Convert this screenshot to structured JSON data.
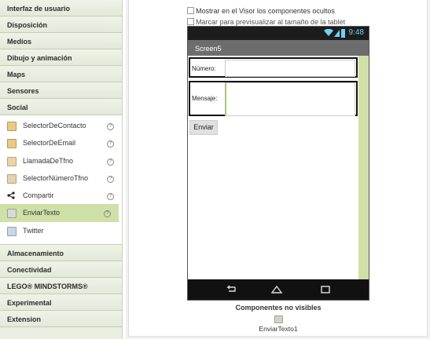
{
  "palette": {
    "categories_top": [
      {
        "label": "Interfaz de usuario"
      },
      {
        "label": "Disposición"
      },
      {
        "label": "Medios"
      },
      {
        "label": "Dibujo y animación"
      },
      {
        "label": "Maps"
      },
      {
        "label": "Sensores"
      },
      {
        "label": "Social"
      }
    ],
    "social_items": [
      {
        "label": "SelectorDeContacto",
        "icon": "contact-picker-icon",
        "help": "?"
      },
      {
        "label": "SelectorDeEmail",
        "icon": "email-picker-icon",
        "help": "?"
      },
      {
        "label": "LlamadaDeTfno",
        "icon": "phone-call-icon",
        "help": "?"
      },
      {
        "label": "SelectorNúmeroTfno",
        "icon": "phone-number-picker-icon",
        "help": "?"
      },
      {
        "label": "Compartir",
        "icon": "share-icon",
        "help": "?"
      },
      {
        "label": "EnviarTexto",
        "icon": "texting-icon",
        "help": "?",
        "selected": true
      },
      {
        "label": "Twitter",
        "icon": "twitter-icon",
        "help": "?"
      }
    ],
    "categories_bottom": [
      {
        "label": "Almacenamiento"
      },
      {
        "label": "Conectividad"
      },
      {
        "label": "LEGO® MINDSTORMS®"
      },
      {
        "label": "Experimental"
      },
      {
        "label": "Extension"
      }
    ]
  },
  "viewer": {
    "show_hidden_label": "Mostrar en el Visor los componentes ocultos",
    "tablet_preview_label": "Marcar para previsualizar al tamaño de la tablet",
    "status_time": "9:48",
    "screen_title": "Screen5",
    "numero_label": "Número:",
    "mensaje_label": "Mensaje:",
    "send_button": "Enviar",
    "nonvisible_title": "Componentes no visibles",
    "nonvisible_item": "EnviarTexto1"
  },
  "colors": {
    "accent_green": "#cfe0a8",
    "status_blue": "#6fd1f5"
  }
}
